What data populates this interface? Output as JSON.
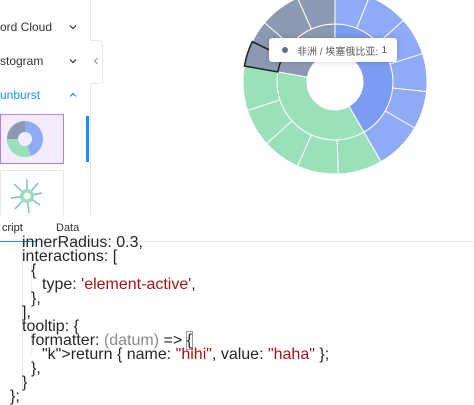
{
  "sidebar": {
    "items": [
      {
        "label": "ord Cloud",
        "icon": "chevron-down-icon"
      },
      {
        "label": "stogram",
        "icon": "chevron-down-icon"
      },
      {
        "label": "unburst",
        "icon": "chevron-up-icon"
      }
    ],
    "collapse_icon": "chevron-left-icon"
  },
  "tooltip": {
    "name": "非洲 / 埃塞俄比亚:",
    "value": "1"
  },
  "tabs": [
    {
      "label": "cript"
    },
    {
      "label": "Data"
    }
  ],
  "code": {
    "lines": [
      "innerRadius: 0.3,",
      "interactions: [",
      "{",
      "type: 'element-active',",
      "},",
      "],",
      "tooltip: {",
      "formatter: (datum) => {",
      "return { name: \"hihi\", value: \"haha\" };",
      "},",
      "}",
      "};"
    ]
  },
  "colors": {
    "accent": "#1890ff",
    "sunburst_blue": "#8fabf5",
    "sunburst_blue_dark": "#7b9cf0",
    "sunburst_green": "#9ae0b8",
    "sunburst_gray": "#8c99b3"
  }
}
